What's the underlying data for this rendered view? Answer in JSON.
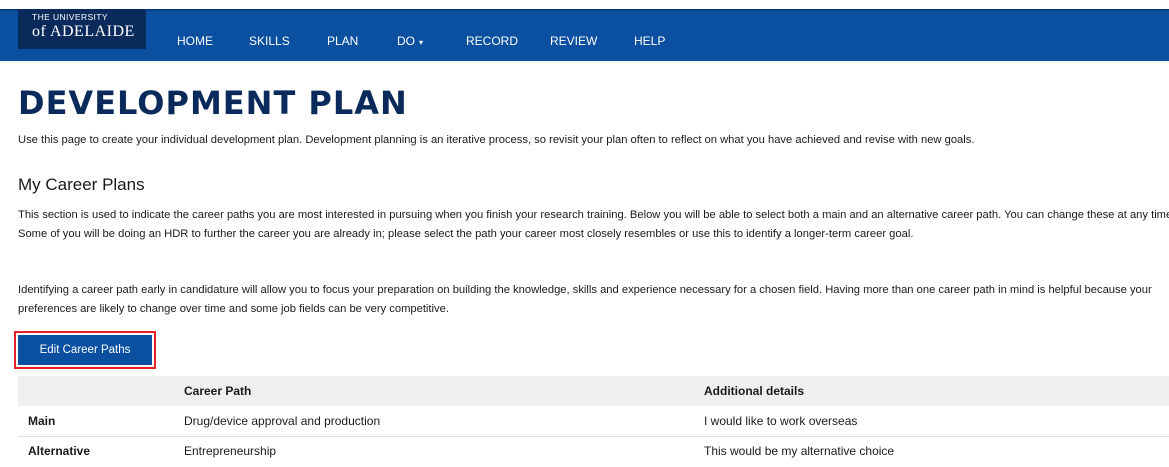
{
  "brand": {
    "top": "THE UNIVERSITY",
    "main": "of ADELAIDE"
  },
  "nav": [
    {
      "label": "HOME"
    },
    {
      "label": "SKILLS"
    },
    {
      "label": "PLAN"
    },
    {
      "label": "DO",
      "caret": "▾"
    },
    {
      "label": "RECORD"
    },
    {
      "label": "REVIEW"
    },
    {
      "label": "HELP"
    }
  ],
  "page": {
    "title": "DEVELOPMENT PLAN",
    "intro": "Use this page to create your individual development plan. Development planning is an iterative process, so revisit your plan often to reflect on what you have achieved and revise with new goals."
  },
  "career": {
    "heading": "My Career Plans",
    "para1": "This section is used to indicate the career paths you are most interested in pursuing when you finish your research training. Below you will be able to select both a main and an alternative career path. You can change these at any time. Some of you will be doing an HDR to further the career you are already in; please select the path your career most closely resembles or use this to identify a longer-term career goal.",
    "para2": "Identifying a career path early in candidature will allow you to focus your preparation on building the knowledge, skills and experience necessary for a chosen field. Having more than one career path in mind is helpful because your preferences are likely to change over time and some job fields can be very competitive.",
    "edit_label": "Edit Career Paths",
    "table": {
      "headers": [
        "",
        "Career Path",
        "Additional details"
      ],
      "rows": [
        [
          "Main",
          "Drug/device approval and production",
          "I would like to work overseas"
        ],
        [
          "Alternative",
          "Entrepreneurship",
          "This would be my alternative choice"
        ]
      ]
    }
  },
  "colors": {
    "nav_bg": "#0a4fa0",
    "logo_bg": "#0b2a5c",
    "title": "#0b2a5c",
    "highlight": "#e8202a"
  }
}
